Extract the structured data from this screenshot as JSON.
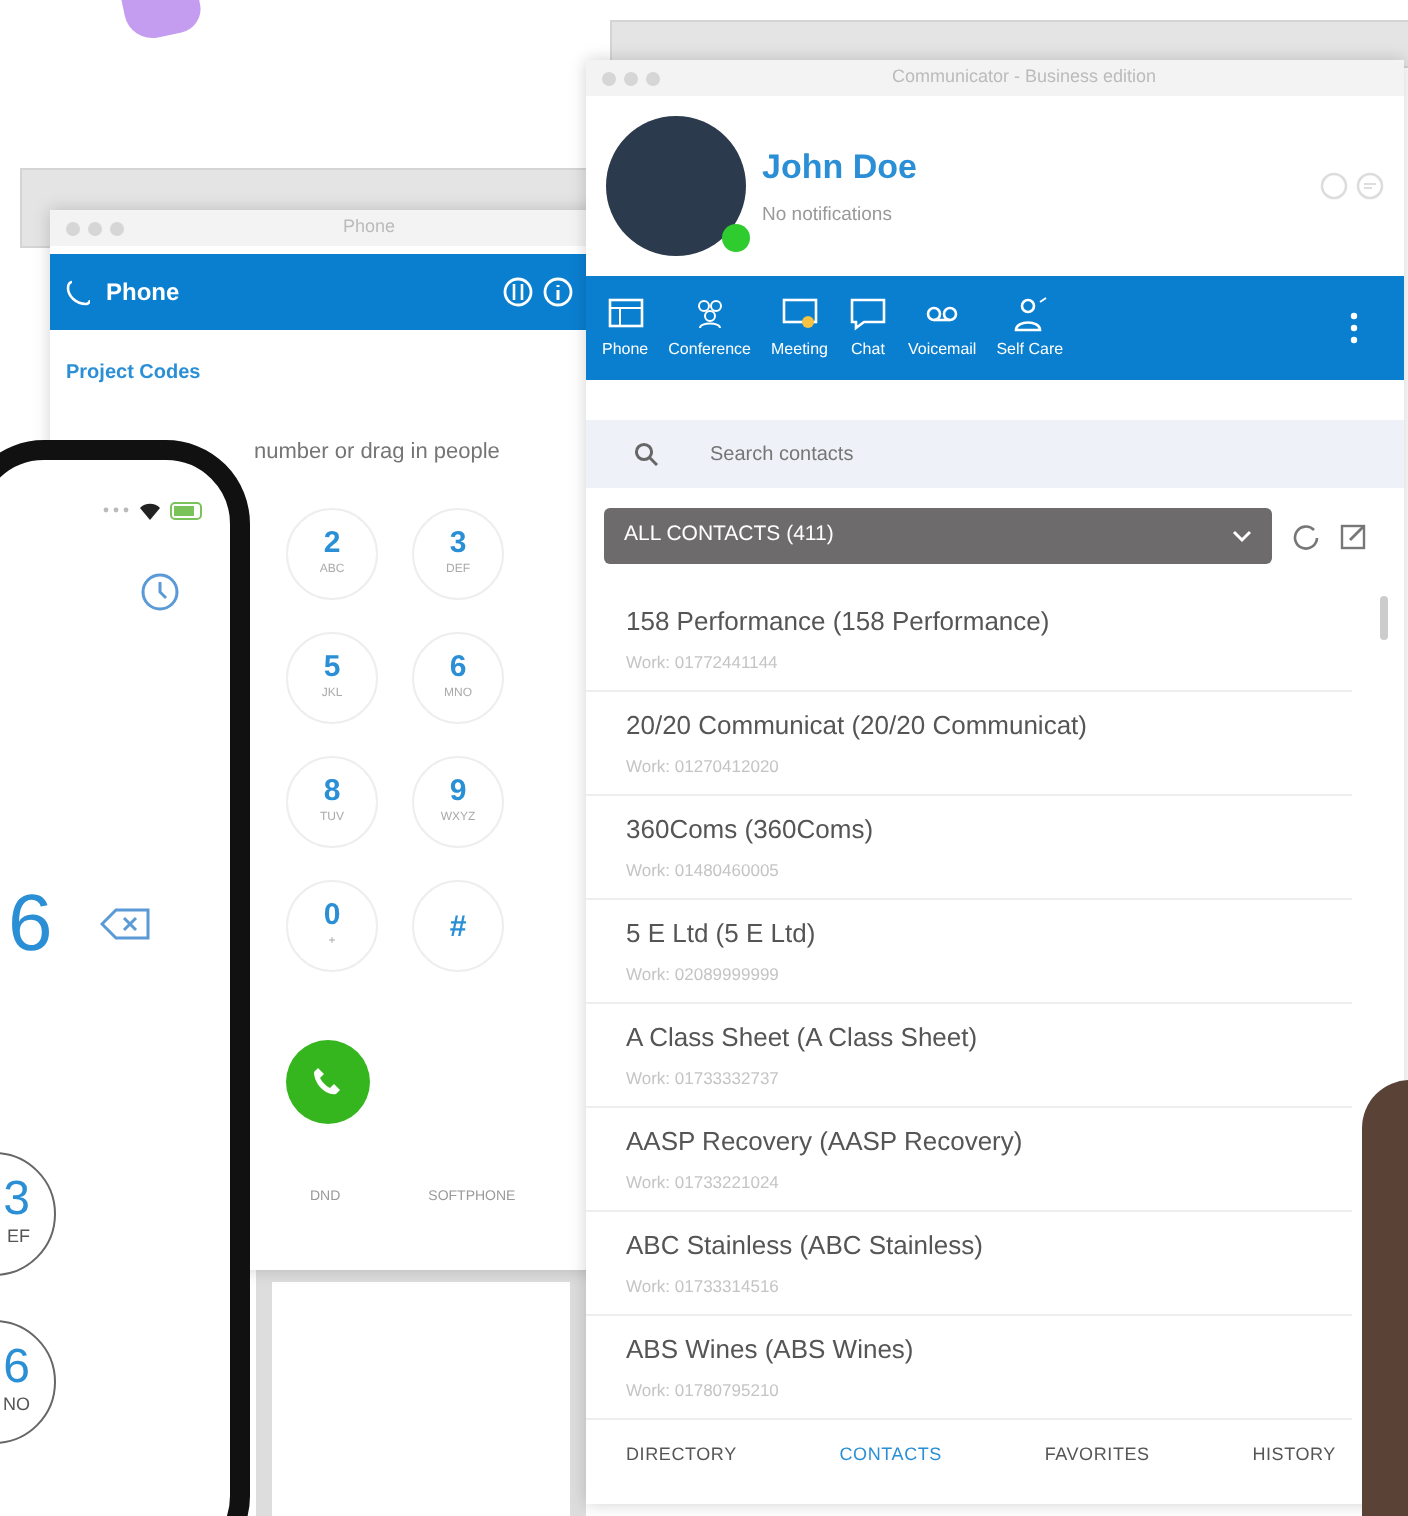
{
  "phone_window": {
    "title": "Phone",
    "header": "Phone",
    "project_codes": "Project Codes",
    "number_field": {
      "placeholder": "number or drag in people"
    },
    "keys": [
      {
        "digit": "2",
        "letters": "ABC"
      },
      {
        "digit": "3",
        "letters": "DEF"
      },
      {
        "digit": "5",
        "letters": "JKL"
      },
      {
        "digit": "6",
        "letters": "MNO"
      },
      {
        "digit": "8",
        "letters": "TUV"
      },
      {
        "digit": "9",
        "letters": "WXYZ"
      },
      {
        "digit": "0",
        "letters": "+"
      },
      {
        "digit": "#"
      }
    ],
    "footer": [
      "DND",
      "SOFTPHONE"
    ]
  },
  "communicator": {
    "title": "Communicator - Business edition",
    "user": {
      "name": "John Doe",
      "status": "No notifications"
    },
    "toolbar": [
      {
        "label": "Phone"
      },
      {
        "label": "Conference"
      },
      {
        "label": "Meeting"
      },
      {
        "label": "Chat"
      },
      {
        "label": "Voicemail"
      },
      {
        "label": "Self Care"
      }
    ],
    "search": {
      "placeholder": "Search contacts"
    },
    "filter": "ALL CONTACTS (411)",
    "contacts": [
      {
        "name": "158 Performance (158 Performance)",
        "detail": "Work: 01772441144"
      },
      {
        "name": "20/20 Communicat (20/20 Communicat)",
        "detail": "Work: 01270412020"
      },
      {
        "name": "360Coms (360Coms)",
        "detail": "Work: 01480460005"
      },
      {
        "name": "5 E Ltd (5 E Ltd)",
        "detail": "Work: 02089999999"
      },
      {
        "name": "A Class Sheet (A Class Sheet)",
        "detail": "Work: 01733332737"
      },
      {
        "name": "AASP Recovery (AASP Recovery)",
        "detail": "Work: 01733221024"
      },
      {
        "name": "ABC Stainless (ABC Stainless)",
        "detail": "Work: 01733314516"
      },
      {
        "name": "ABS Wines (ABS Wines)",
        "detail": "Work: 01780795210"
      }
    ],
    "tabs": [
      {
        "label": "DIRECTORY",
        "selected": false
      },
      {
        "label": "CONTACTS",
        "selected": true
      },
      {
        "label": "FAVORITES",
        "selected": false
      },
      {
        "label": "HISTORY",
        "selected": false
      }
    ]
  },
  "mobile": {
    "display": "6",
    "keys": [
      {
        "digit": "3",
        "letters": "EF"
      },
      {
        "digit": "6",
        "letters": "NO"
      }
    ]
  }
}
